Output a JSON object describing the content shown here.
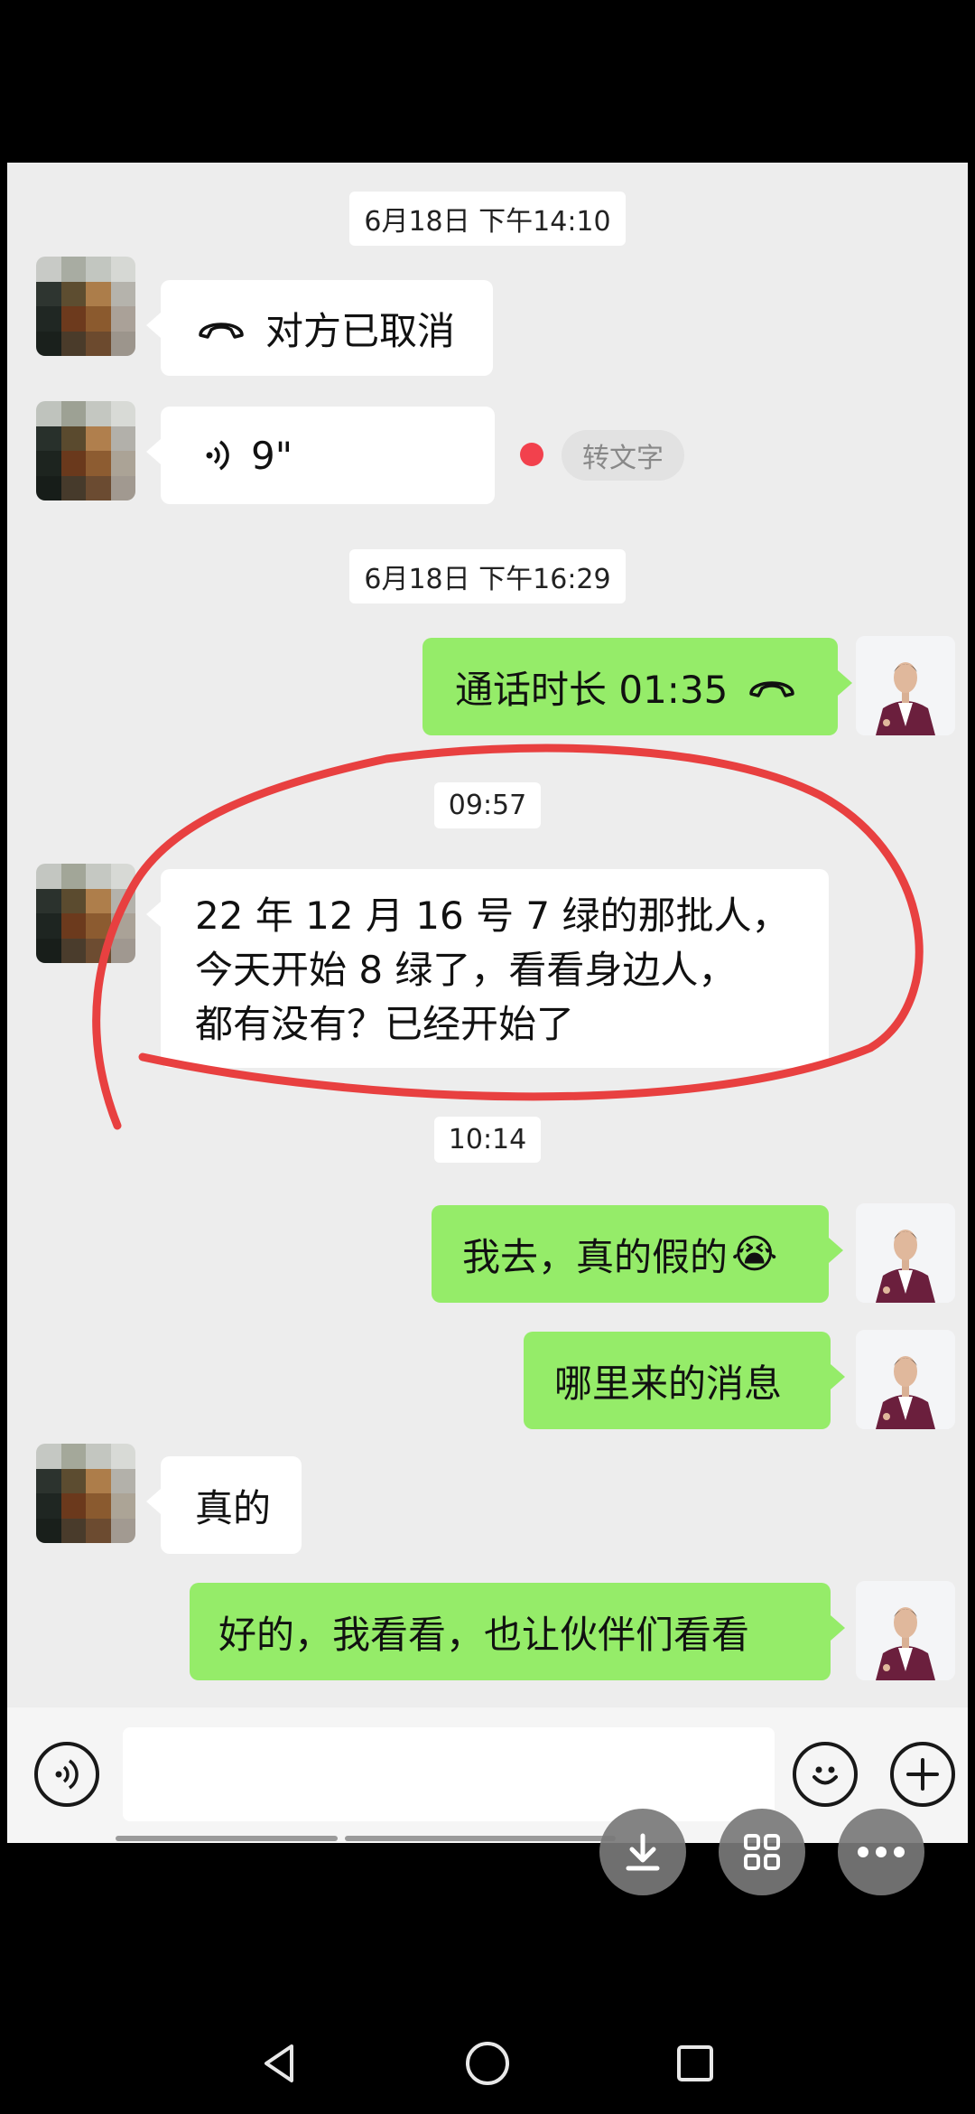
{
  "chat": {
    "timestamps": [
      "6月18日 下午14:10",
      "6月18日 下午16:29",
      "09:57",
      "10:14"
    ],
    "messages": {
      "call_cancelled": "对方已取消",
      "voice_duration": "9\"",
      "voice_to_text": "转文字",
      "call_duration": "通话时长 01:35",
      "long_line1": "22 年 12 月 16 号 7 绿的那批人，",
      "long_line2": "今天开始 8 绿了，看看身边人，",
      "long_line3": "都有没有？已经开始了",
      "me_1": "我去，真的假的",
      "me_1_emoji": "😭",
      "me_2": "哪里来的消息",
      "other_reply": "真的",
      "me_3": "好的，我看看，也让伙伴们看看"
    }
  },
  "colors": {
    "chat_background": "#ededed",
    "bubble_sent": "#95ec69",
    "bubble_received": "#ffffff",
    "annotation_circle": "#e84040",
    "unread_dot": "#f2414d"
  },
  "icons": {
    "call_end": "phone-hangup-icon",
    "voice": "voice-wave-icon",
    "voice_input": "voice-input-icon",
    "emoji": "emoji-icon",
    "more": "plus-icon",
    "download": "download-icon",
    "grid": "grid-icon",
    "menu": "more-dots-icon",
    "back": "back-triangle-icon",
    "home": "home-circle-icon",
    "recents": "recents-square-icon"
  }
}
